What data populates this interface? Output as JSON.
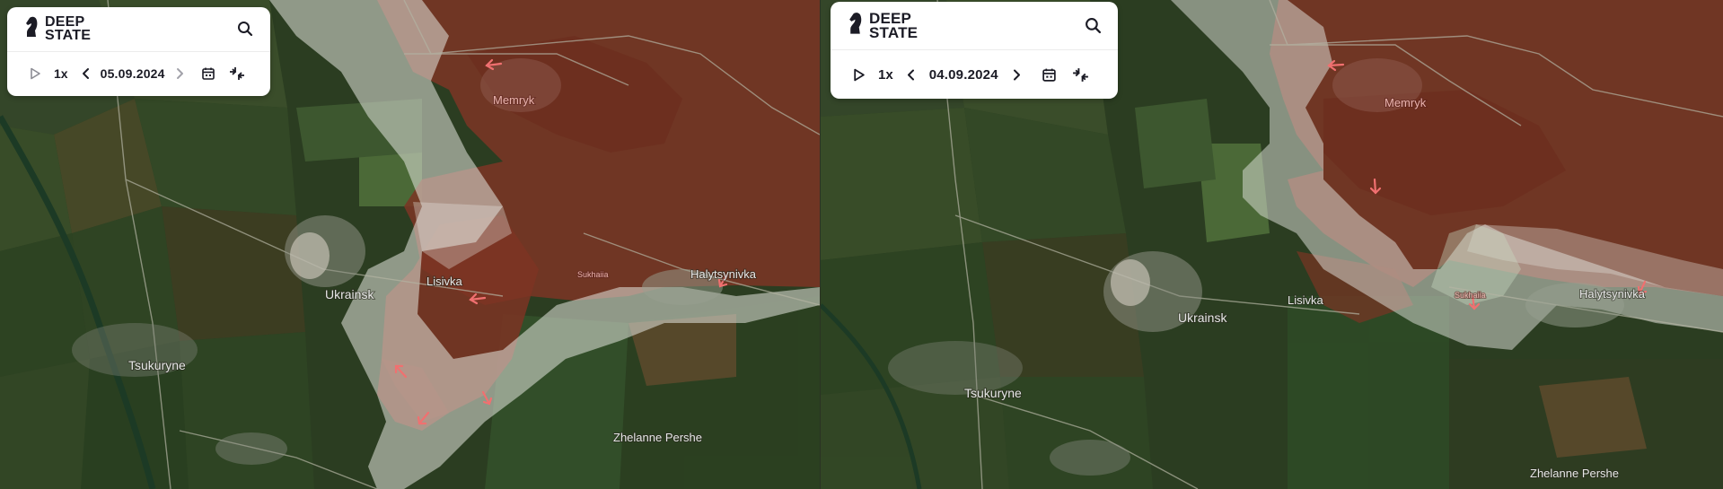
{
  "app": {
    "logo_line1": "DEEP",
    "logo_line2": "STATE"
  },
  "panels": [
    {
      "playback_speed": "1x",
      "date": "05.09.2024",
      "labels": {
        "memryk": "Memryk",
        "lisivka": "Lisivka",
        "ukrainsk": "Ukrainsk",
        "tsukuryne": "Tsukuryne",
        "halytsynivka": "Halytsynivka",
        "zhelanne": "Zhelanne Pershe",
        "sukhaiia": "Sukhaiia"
      }
    },
    {
      "playback_speed": "1x",
      "date": "04.09.2024",
      "labels": {
        "memryk": "Memryk",
        "lisivka": "Lisivka",
        "ukrainsk": "Ukrainsk",
        "tsukuryne": "Tsukuryne",
        "halytsynivka": "Halytsynivka",
        "zhelanne": "Zhelanne Pershe",
        "sukhaiia": "Sukhaiia"
      }
    }
  ],
  "colors": {
    "occupied": "#8a3a2a",
    "contested": "#e4e6df",
    "fields_dark": "#25371c",
    "arrow": "#f07070"
  }
}
